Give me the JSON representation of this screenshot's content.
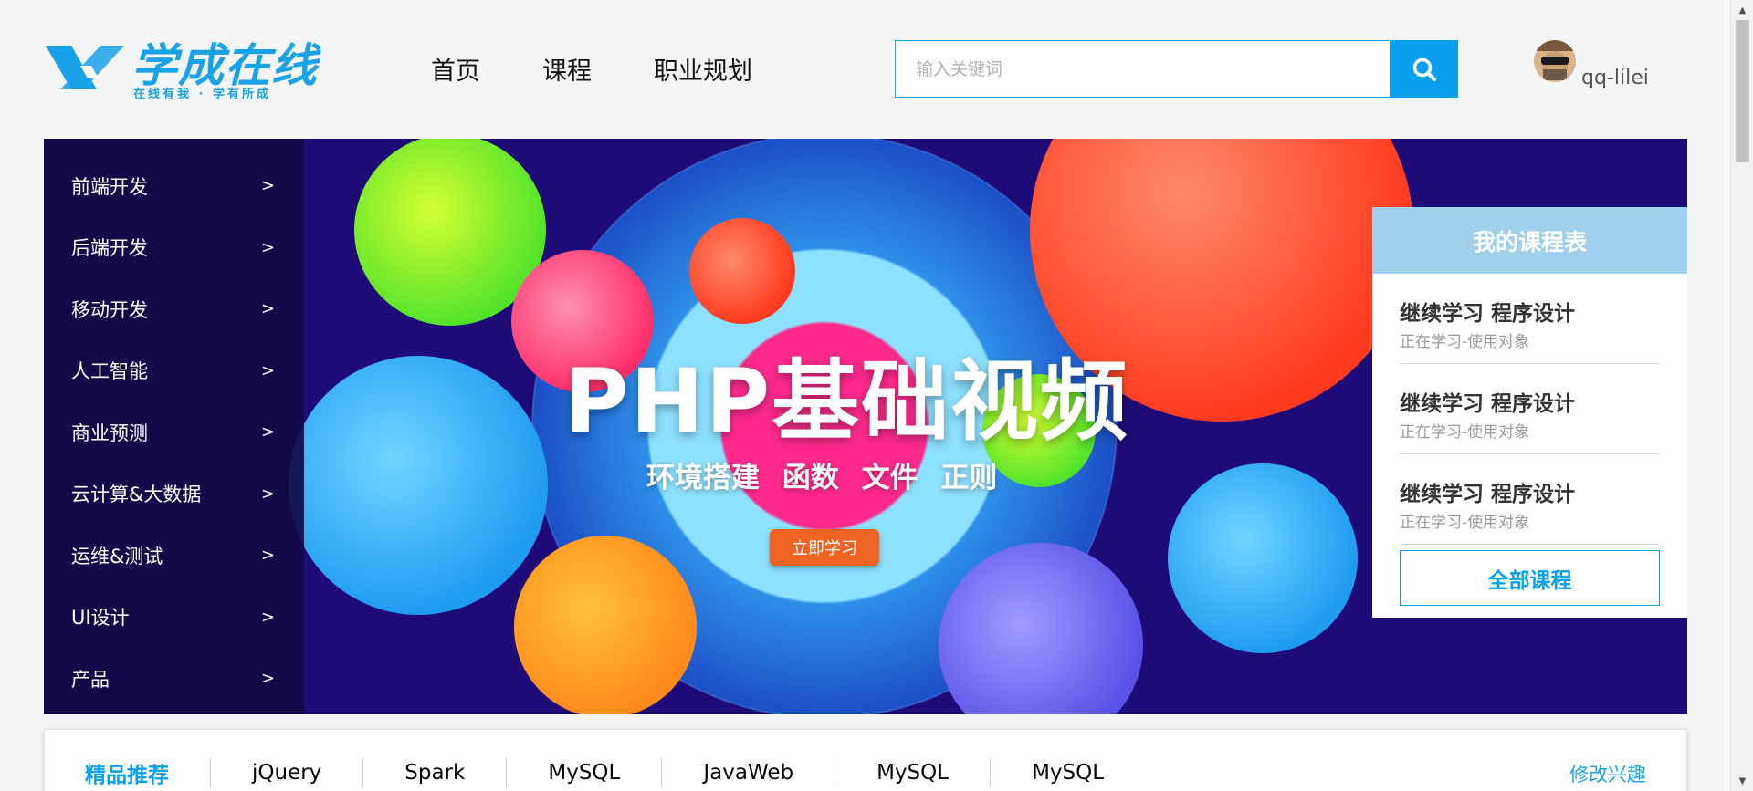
{
  "logo": {
    "brand": "学成在线",
    "tagline": "在线有我 · 学有所成"
  },
  "nav": {
    "items": [
      "首页",
      "课程",
      "职业规划"
    ]
  },
  "search": {
    "placeholder": "输入关键词",
    "value": "",
    "button_icon": "search-icon"
  },
  "user": {
    "name": "qq-lilei",
    "avatar": "user-avatar"
  },
  "categories": [
    {
      "label": "前端开发",
      "arrow": ">"
    },
    {
      "label": "后端开发",
      "arrow": ">"
    },
    {
      "label": "移动开发",
      "arrow": ">"
    },
    {
      "label": "人工智能",
      "arrow": ">"
    },
    {
      "label": "商业预测",
      "arrow": ">"
    },
    {
      "label": "云计算&大数据",
      "arrow": ">"
    },
    {
      "label": "运维&测试",
      "arrow": ">"
    },
    {
      "label": "UI设计",
      "arrow": ">"
    },
    {
      "label": "产品",
      "arrow": ">"
    }
  ],
  "banner": {
    "title": "PHP基础视频",
    "subtitle": "环境搭建 函数 文件 正则",
    "cta": "立即学习"
  },
  "course_panel": {
    "title": "我的课程表",
    "items": [
      {
        "title": "继续学习 程序设计",
        "subtitle": "正在学习-使用对象"
      },
      {
        "title": "继续学习 程序设计",
        "subtitle": "正在学习-使用对象"
      },
      {
        "title": "继续学习 程序设计",
        "subtitle": "正在学习-使用对象"
      }
    ],
    "all_button": "全部课程"
  },
  "recommend": {
    "items": [
      "精品推荐",
      "jQuery",
      "Spark",
      "MySQL",
      "JavaWeb",
      "MySQL",
      "MySQL"
    ],
    "active_index": 0,
    "edit_label": "修改兴趣"
  },
  "colors": {
    "accent": "#0aa0ef",
    "banner_bg": "#1a0a6e",
    "cta": "#f06322",
    "panel_head": "#9fd0ec"
  }
}
